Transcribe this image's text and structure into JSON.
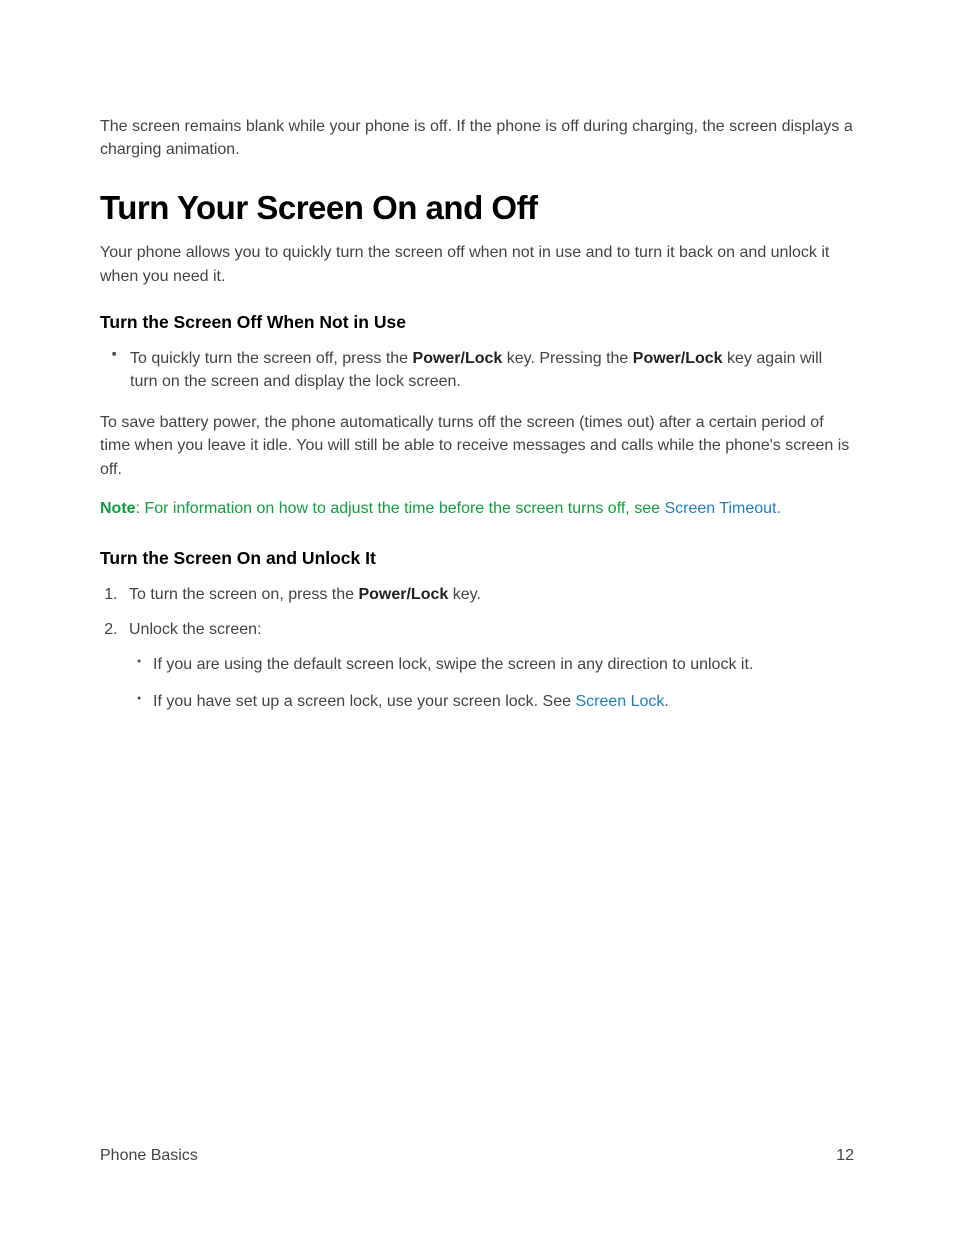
{
  "intro": "The screen remains blank while your phone is off. If the phone is off during charging, the screen displays a charging animation.",
  "heading_main": "Turn Your Screen On and Off",
  "intro2": "Your phone allows you to quickly turn the screen off when not in use and to turn it back on and unlock it when you need it.",
  "section1": {
    "heading": "Turn the Screen Off When Not in Use",
    "bullet_pre": "To quickly turn the screen off, press the ",
    "bullet_bold1": "Power/Lock",
    "bullet_mid": " key. Pressing the ",
    "bullet_bold2": "Power/Lock",
    "bullet_post": " key again will turn on the screen and display the lock screen.",
    "para": "To save battery power, the phone automatically turns off the screen (times out) after a certain period of time when you leave it idle. You will still be able to receive messages and calls while the phone's screen is off.",
    "note_label": "Note",
    "note_text": ": For information on how to adjust the time before the screen turns off, see ",
    "note_link": "Screen Timeout",
    "note_after": "."
  },
  "section2": {
    "heading": "Turn the Screen On and Unlock It",
    "ol1_pre": "To turn the screen on, press the ",
    "ol1_bold": "Power/Lock",
    "ol1_post": " key.",
    "ol2": "Unlock the screen:",
    "sub1": "If you are using the default screen lock, swipe the screen in any direction to unlock it.",
    "sub2_pre": "If you have set up a screen lock, use your screen lock. See ",
    "sub2_link": "Screen Lock",
    "sub2_post": "."
  },
  "footer": {
    "section": "Phone Basics",
    "page": "12"
  }
}
